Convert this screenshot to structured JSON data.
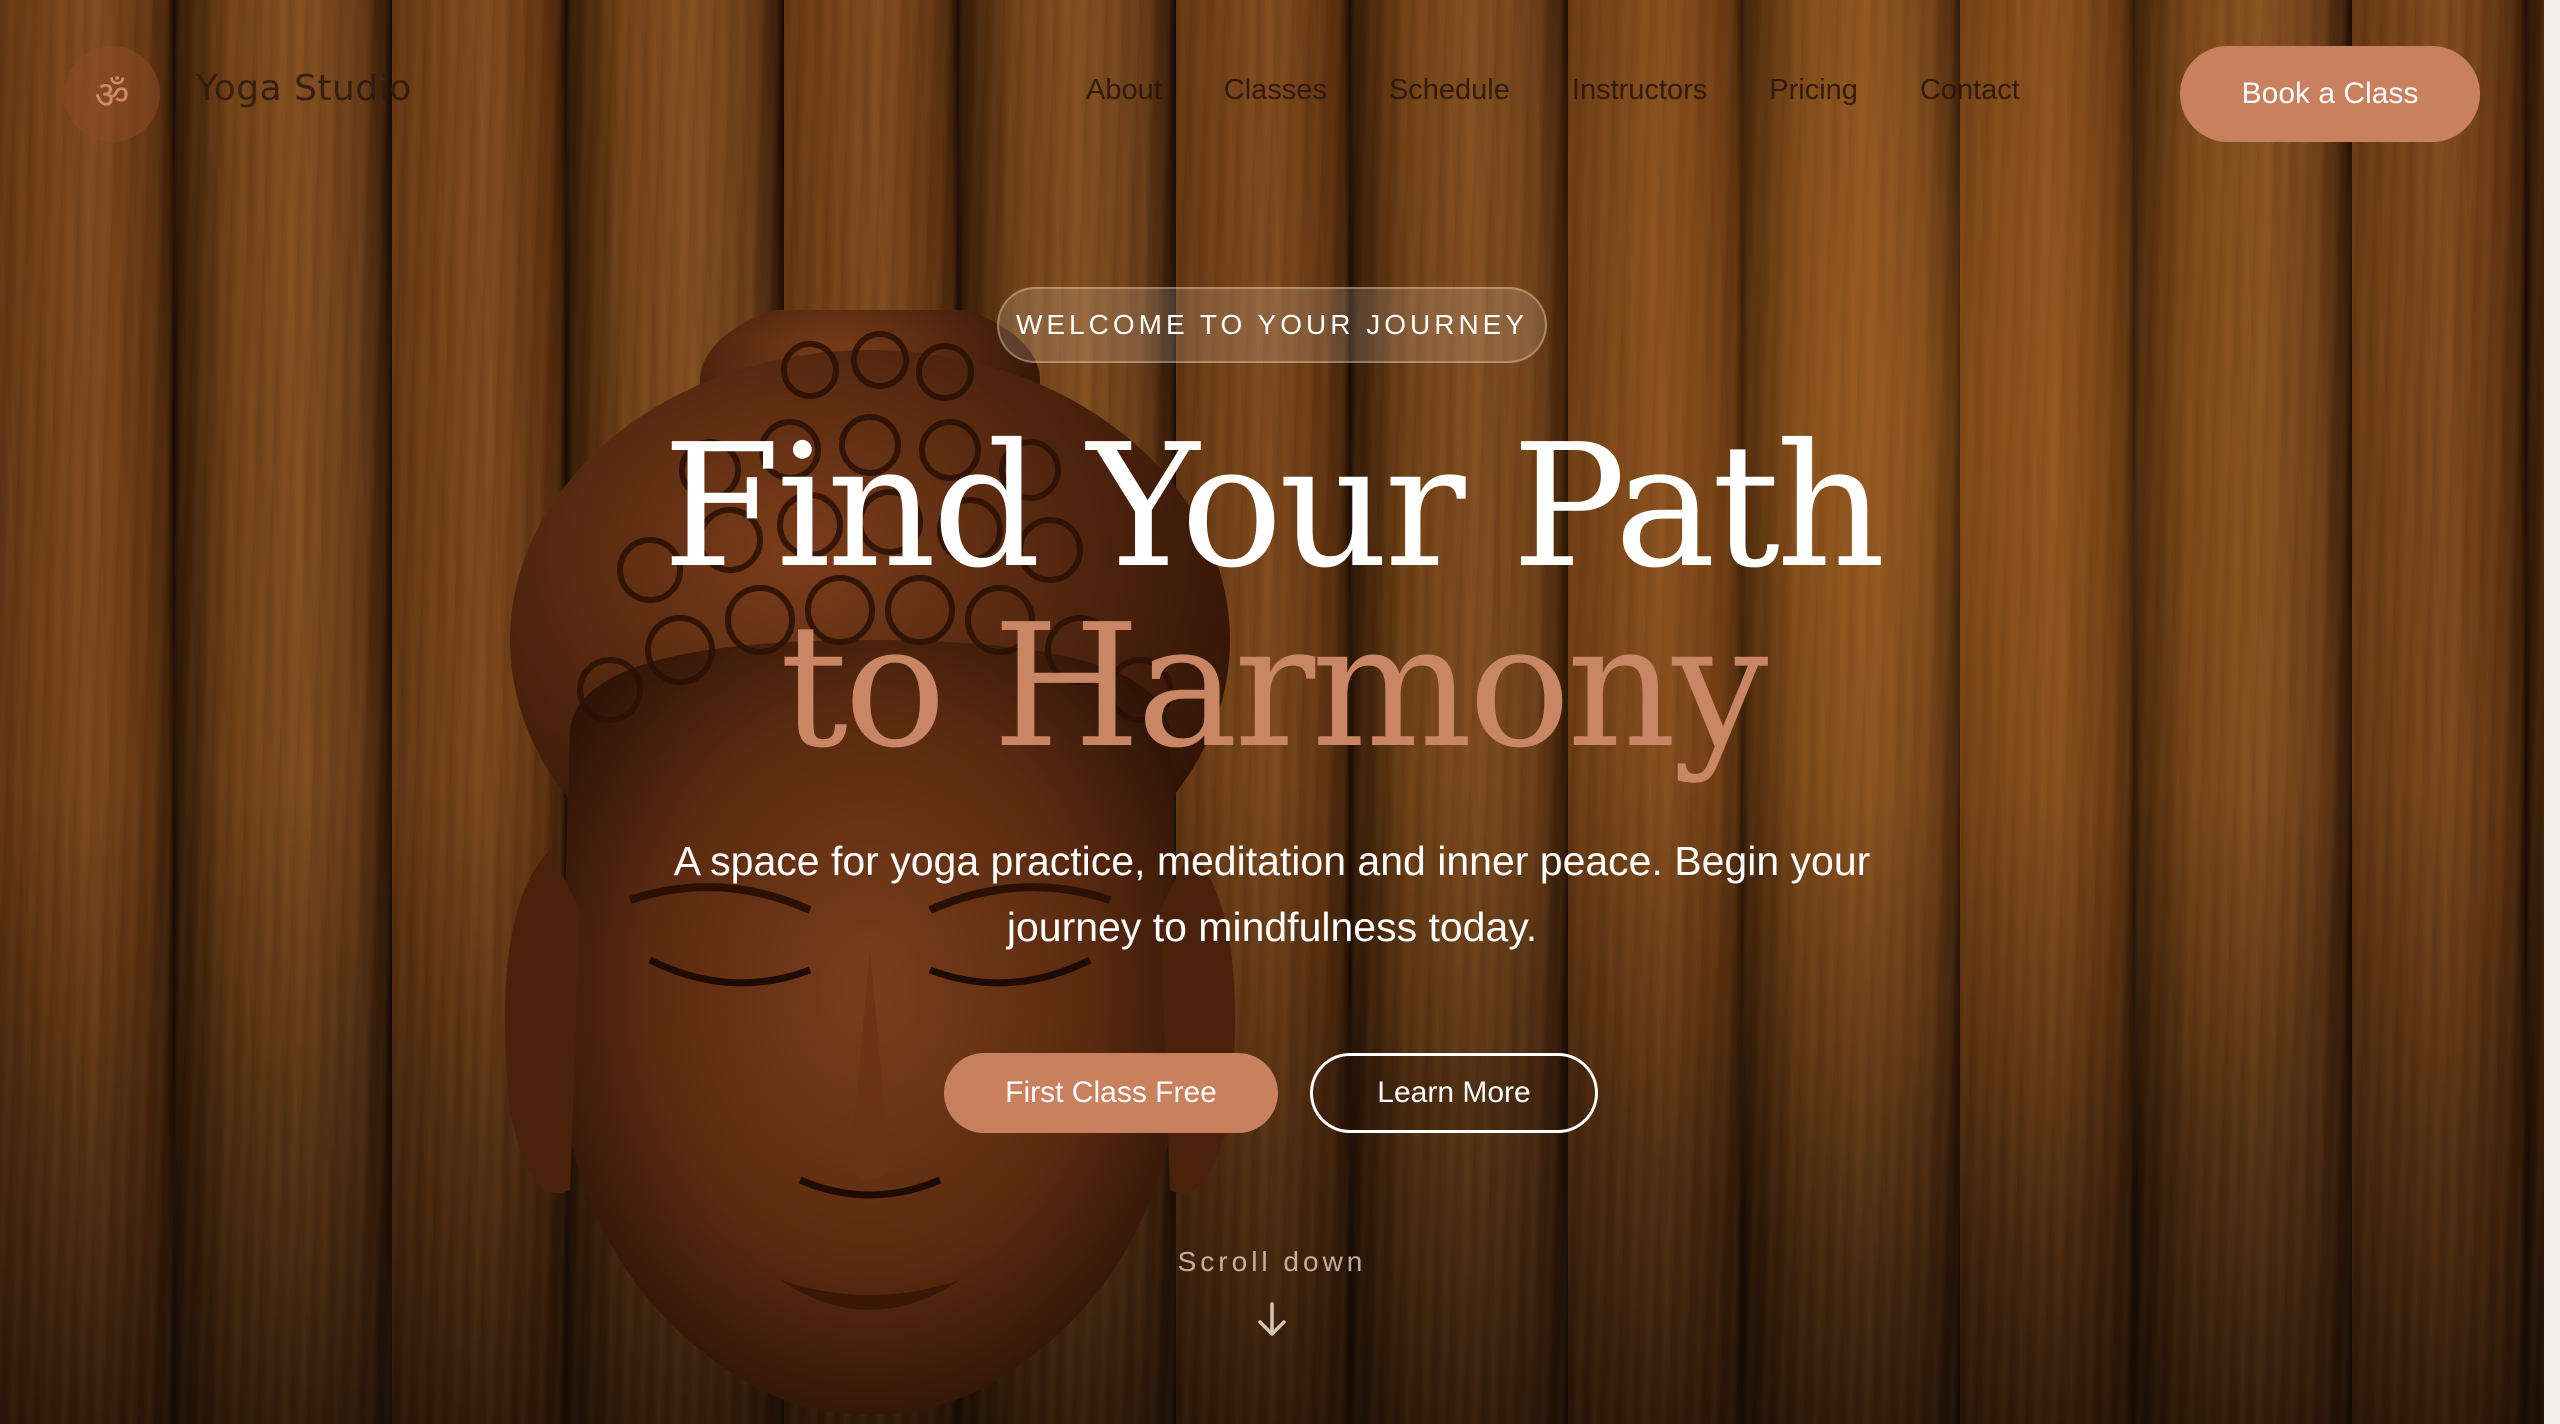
{
  "nav": {
    "logo_glyph": "ॐ",
    "brand": "Yoga Studio",
    "links": [
      "About",
      "Classes",
      "Schedule",
      "Instructors",
      "Pricing",
      "Contact"
    ],
    "cta": "Book a Class"
  },
  "hero": {
    "badge": "WELCOME TO YOUR JOURNEY",
    "title_line1": "Find Your Path",
    "title_line2": "to Harmony",
    "subtitle": "A space for yoga practice, meditation and inner peace. Begin your journey to mindfulness today.",
    "primary_cta": "First Class Free",
    "secondary_cta": "Learn More",
    "scroll_label": "Scroll down"
  },
  "colors": {
    "accent": "#c9805f",
    "title_accent": "#c98665",
    "text": "#ffffff"
  },
  "icons": {
    "logo": "om-icon",
    "scroll": "arrow-down-icon"
  }
}
